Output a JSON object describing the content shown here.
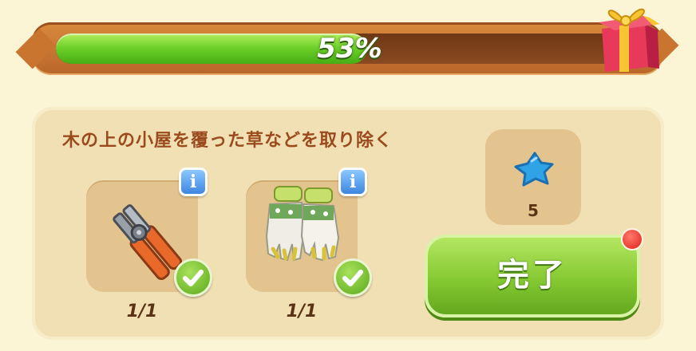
{
  "progress": {
    "label": "53%",
    "fraction": 0.53
  },
  "task": {
    "title": "木の上の小屋を覆った草などを取り除く"
  },
  "items": [
    {
      "icon": "pliers-icon",
      "count": "1/1",
      "completed": true
    },
    {
      "icon": "gloves-icon",
      "count": "1/1",
      "completed": true
    }
  ],
  "reward": {
    "icon": "blue-star-icon",
    "value": "5"
  },
  "complete_button": {
    "label": "完了"
  },
  "colors": {
    "accent_green": "#6fd12a",
    "frame_orange": "#d98a3c",
    "title_brown": "#9a4a1c",
    "info_blue": "#3d86e0",
    "notify_red": "#e0201a"
  }
}
